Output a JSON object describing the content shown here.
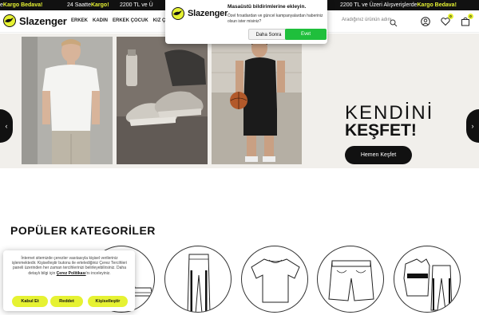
{
  "ticker": [
    {
      "text": "e ",
      "highlight": "Kargo Bedava!"
    },
    {
      "text": "24 Saatte ",
      "highlight": "Kargo!"
    },
    {
      "text": "2200 TL ve Ü",
      "highlight": ""
    },
    {
      "text": "2200 TL ve Üzeri Alışverişlerde ",
      "highlight": "Kargo Bedava!"
    }
  ],
  "header": {
    "brand": "Slazenger",
    "nav": [
      "ERKEK",
      "KADIN",
      "ERKEK ÇOCUK",
      "KIZ Ç"
    ],
    "search_placeholder": "Aradığınız ürünün adını",
    "wishlist_count": "0",
    "cart_count": "0"
  },
  "popup": {
    "brand": "Slazenger",
    "title": "Masaüstü bildirimlerine ekleyin.",
    "desc": "Özel fırsatlardan ve güncel kampanyalardan haberiniz olsun ister misiniz?",
    "deny": "Daha Sonra",
    "accept": "Evet"
  },
  "hero": {
    "title_line1": "KENDİNİ",
    "title_line2": "KEŞFET!",
    "cta": "Hemen Keşfet",
    "prev": "‹",
    "next": "›"
  },
  "categories": {
    "title": "POPÜLER KATEGORİLER"
  },
  "cookie": {
    "text_before": "İnternet sitemizde çerezler vasıtasıyla kişisel verileriniz işlenmektedir. Kişiselleştir butonu ile ertelediğiniz Çerez Tercihleri paneli üzerinden her zaman tercihlerinizi belirleyebilirsiniz. Daha detaylı bilgi için",
    "link": "Çerez Politikası",
    "text_after": "'nı inceleyiniz.",
    "accept": "Kabul Et",
    "reject": "Reddet",
    "customize": "Kişiselleştir"
  }
}
